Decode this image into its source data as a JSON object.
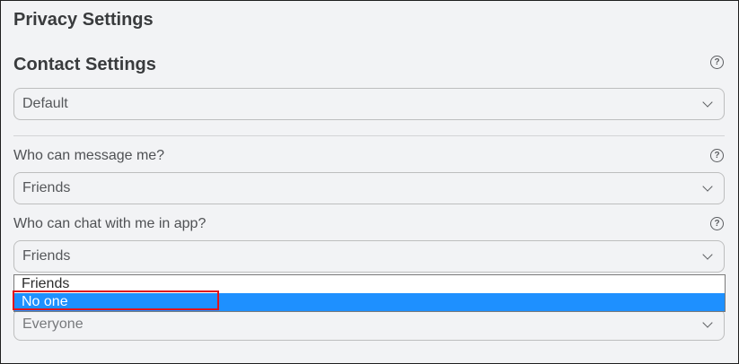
{
  "page": {
    "title": "Privacy Settings"
  },
  "contact_settings": {
    "title": "Contact Settings",
    "help_icon": "question-circle-icon",
    "selected_value": "Default"
  },
  "message_setting": {
    "label": "Who can message me?",
    "selected_value": "Friends"
  },
  "chat_setting": {
    "label": "Who can chat with me in app?",
    "selected_value": "Friends",
    "dropdown_open": true,
    "options": [
      "Friends",
      "No one"
    ],
    "highlighted_option": "No one"
  },
  "next_setting": {
    "selected_value": "Everyone"
  },
  "colors": {
    "highlight_row": "#1e90ff",
    "annotation_box": "#e0131d"
  }
}
